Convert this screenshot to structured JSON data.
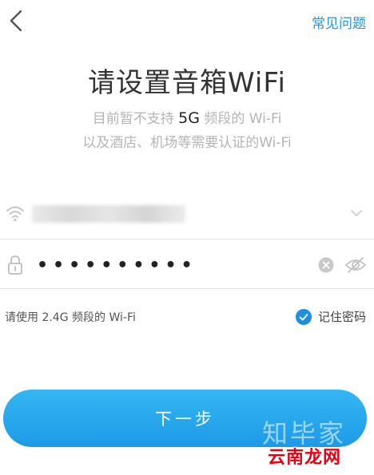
{
  "header": {
    "back_icon": "chevron-left-icon",
    "faq_label": "常见问题"
  },
  "title": "请设置音箱WiFi",
  "subtitle": {
    "line1_prefix": "目前暂不支持",
    "line1_strong": "5G",
    "line1_suffix": "频段的 Wi-Fi",
    "line2": "以及酒店、机场等需要认证的Wi-Fi"
  },
  "wifi_field": {
    "icon": "wifi-icon",
    "ssid_value": "",
    "dropdown_icon": "chevron-down-icon"
  },
  "password_field": {
    "icon": "lock-icon",
    "value": "••••••••••",
    "clear_icon": "clear-circle-icon",
    "visibility_icon": "eye-off-icon"
  },
  "hint": "请使用 2.4G 频段的 Wi-Fi",
  "remember": {
    "label": "记住密码",
    "checked": true
  },
  "next_button_label": "下一步",
  "watermark": {
    "text1": "知毕家",
    "text2": "云南龙网"
  },
  "colors": {
    "accent": "#2a93d8",
    "button": "#1d9ae7",
    "muted_text": "#b4b4b4"
  }
}
